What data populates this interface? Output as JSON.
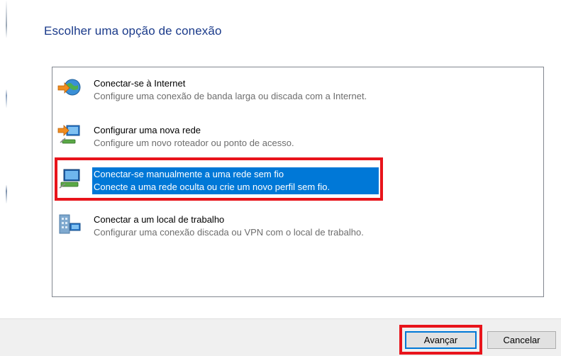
{
  "title": "Escolher uma opção de conexão",
  "options": [
    {
      "title": "Conectar-se à Internet",
      "description": "Configure uma conexão de banda larga ou discada com a Internet.",
      "icon": "globe-connection-icon"
    },
    {
      "title": "Configurar uma nova rede",
      "description": "Configure um novo roteador ou ponto de acesso.",
      "icon": "new-network-icon"
    },
    {
      "title": "Conectar-se manualmente a uma rede sem fio",
      "description": "Conecte a uma rede oculta ou crie um novo perfil sem fio.",
      "icon": "wireless-network-icon",
      "selected": true
    },
    {
      "title": "Conectar a um local de trabalho",
      "description": "Configurar uma conexão discada ou VPN com o local de trabalho.",
      "icon": "workplace-vpn-icon"
    }
  ],
  "buttons": {
    "next": "Avançar",
    "cancel": "Cancelar"
  },
  "colors": {
    "title": "#1a3a8a",
    "selection": "#0078d7",
    "annotation": "#e8141b"
  }
}
